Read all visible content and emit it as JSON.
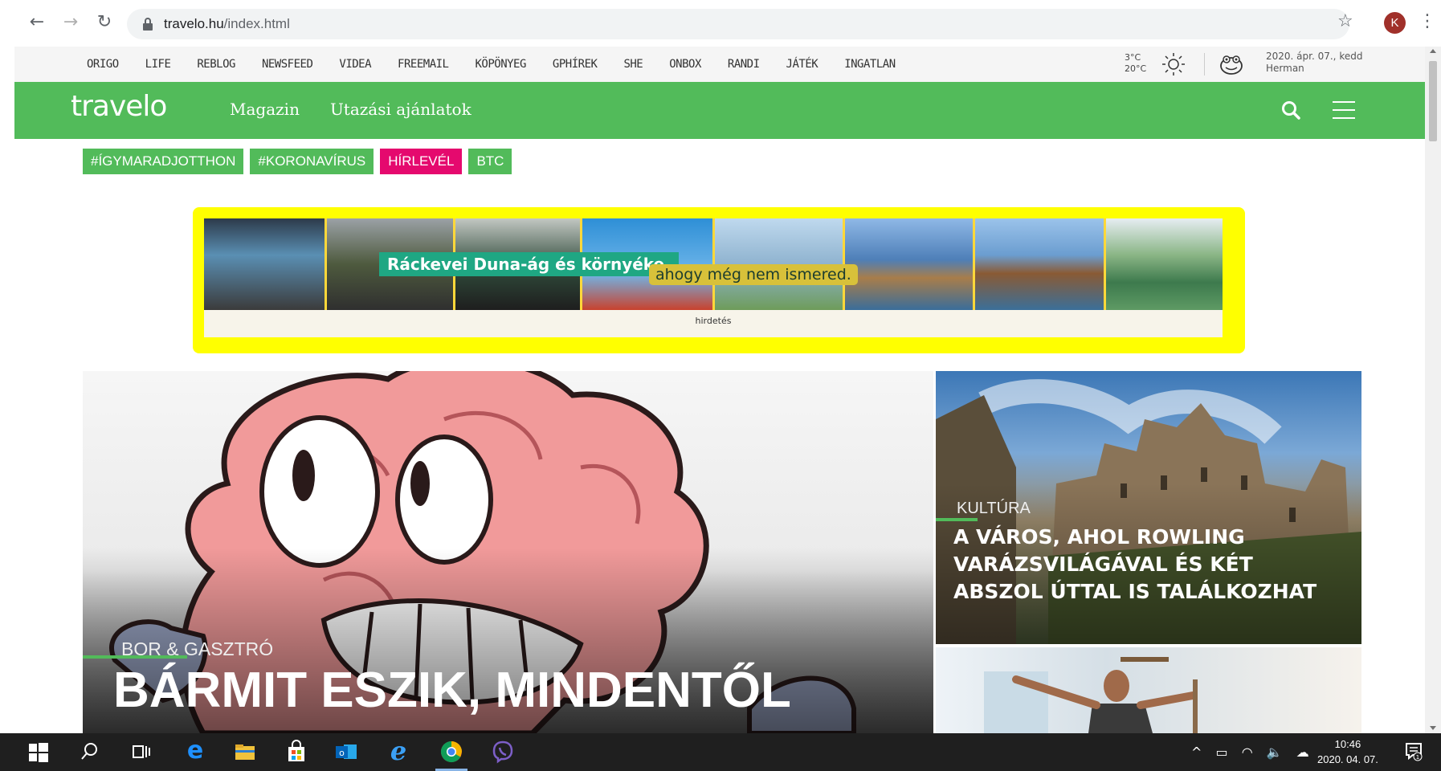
{
  "browser": {
    "url_host": "travelo.hu",
    "url_path": "/index.html",
    "profile_initial": "K"
  },
  "network_bar": {
    "links": [
      "ORIGO",
      "LIFE",
      "REBLOG",
      "NEWSFEED",
      "VIDEA",
      "FREEMAIL",
      "KÖPÖNYEG",
      "GPHÍREK",
      "SHE",
      "ONBOX",
      "RANDI",
      "JÁTÉK",
      "INGATLAN"
    ],
    "temp_low": "3°C",
    "temp_high": "20°C",
    "date": "2020. ápr. 07., kedd",
    "nameday": "Herman"
  },
  "header": {
    "logo": "travelo",
    "nav": [
      "Magazin",
      "Utazási ajánlatok"
    ],
    "brand_color": "#52bb5a"
  },
  "tags": [
    {
      "label": "#ÍGYMARADJOTTHON",
      "color": "#52bb5a"
    },
    {
      "label": "#KORONAVÍRUS",
      "color": "#52bb5a"
    },
    {
      "label": "HÍRLEVÉL",
      "color": "#e5096e"
    },
    {
      "label": "BTC",
      "color": "#52bb5a"
    }
  ],
  "ad": {
    "title": "Ráckevei Duna-ág és környéke,",
    "subtitle": "ahogy még nem ismered.",
    "label": "hirdetés"
  },
  "hero": {
    "category": "BOR & GASZTRÓ",
    "title": "BÁRMIT ESZIK, MINDENTŐL"
  },
  "card1": {
    "category": "KULTÚRA",
    "title": "A VÁROS, AHOL ROWLING VARÁZSVILÁGÁVAL ÉS KÉT ABSZOL ÚTTAL IS TALÁLKOZHAT"
  },
  "taskbar": {
    "time": "10:46",
    "date": "2020. 04. 07.",
    "notifications": "1"
  }
}
